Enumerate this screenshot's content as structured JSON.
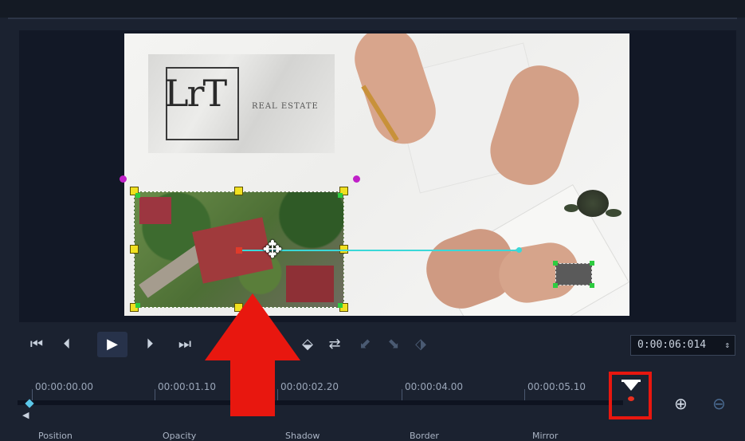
{
  "preview": {
    "logo_mark": "LrT",
    "logo_sub": "REAL ESTATE"
  },
  "toolbar": {
    "buttons": [
      {
        "name": "go-to-start",
        "glyph": "⏮"
      },
      {
        "name": "previous-frame",
        "glyph": "◀"
      },
      {
        "name": "play",
        "glyph": "▶"
      },
      {
        "name": "next-frame",
        "glyph": "▶"
      },
      {
        "name": "go-to-end",
        "glyph": "⏭"
      }
    ],
    "timecode": "0:00:06:014",
    "timecode_stepper": "⇕"
  },
  "timeline": {
    "labels": [
      "00:00:00.00",
      "00:00:01.10",
      "00:00:02.20",
      "00:00:04.00",
      "00:00:05.10"
    ]
  },
  "bottom": {
    "labels": [
      "Position",
      "Opacity",
      "Shadow",
      "Border",
      "Mirror"
    ]
  },
  "colors": {
    "accent_red": "#e8170f",
    "path_cyan": "#3ad8d8",
    "handle_yellow": "#f0e020"
  }
}
